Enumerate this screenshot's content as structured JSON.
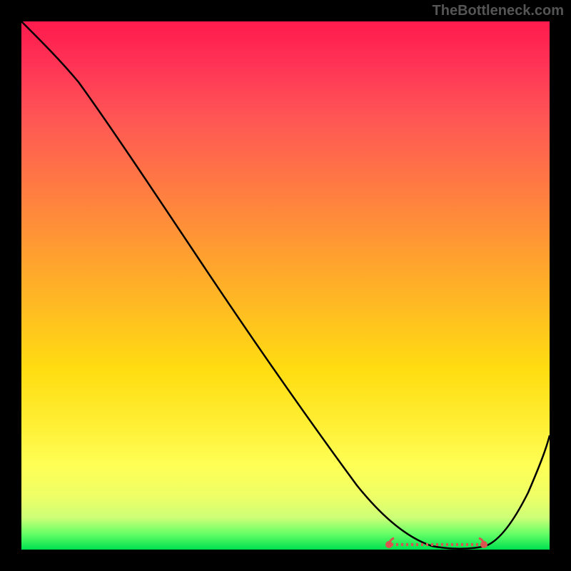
{
  "watermark": "TheBottleneck.com",
  "chart_data": {
    "type": "line",
    "title": "",
    "xlabel": "",
    "ylabel": "",
    "xlim": [
      0,
      100
    ],
    "ylim": [
      0,
      100
    ],
    "series": [
      {
        "name": "bottleneck-curve",
        "color": "#000000",
        "x": [
          0,
          5,
          10,
          15,
          20,
          25,
          30,
          35,
          40,
          45,
          50,
          55,
          60,
          65,
          70,
          75,
          80,
          85,
          90,
          95,
          100
        ],
        "y": [
          100,
          96,
          91,
          85,
          78,
          71,
          63,
          56,
          48,
          41,
          33,
          26,
          18,
          11,
          5,
          1,
          0,
          0,
          4,
          12,
          23
        ]
      },
      {
        "name": "optimal-zone",
        "color": "#d9534f",
        "type": "marker-band",
        "x_start": 70,
        "x_end": 88,
        "y": 2
      }
    ],
    "background_gradient": {
      "top": "#ff1a4d",
      "mid": "#ffee33",
      "bottom": "#00e050"
    }
  }
}
